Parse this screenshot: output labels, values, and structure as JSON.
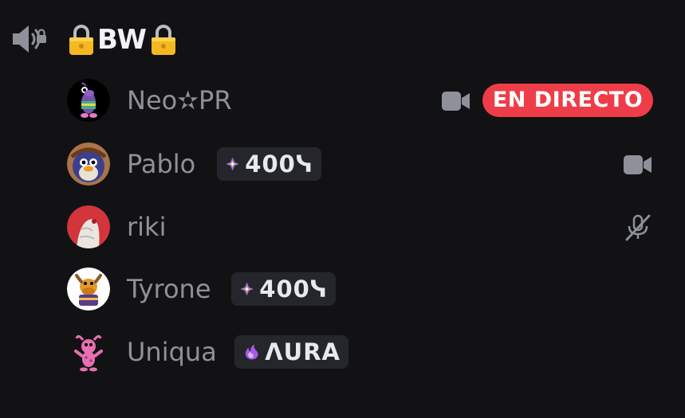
{
  "channel": {
    "icon": "speaker-locked-icon",
    "lock_icon": "lock-icon",
    "name": "BW"
  },
  "members": [
    {
      "name": "Neo✫PR",
      "avatar": "purple-character-avatar",
      "status_icon": "camera-icon",
      "live_label": "EN DIRECTO"
    },
    {
      "name": "Pablo",
      "avatar": "penguin-avatar",
      "badge": {
        "icon": "sparkle-gem-icon",
        "text": "400ᓭ"
      },
      "status_icon": "camera-icon"
    },
    {
      "name": "riki",
      "avatar": "photo-avatar",
      "status_icon": "mic-muted-icon"
    },
    {
      "name": "Tyrone",
      "avatar": "moose-avatar",
      "badge": {
        "icon": "sparkle-gem-icon",
        "text": "400ᓭ"
      }
    },
    {
      "name": "Uniqua",
      "avatar": "pink-character-avatar",
      "badge": {
        "icon": "purple-flame-icon",
        "text": "ΛURA"
      }
    }
  ],
  "colors": {
    "background": "#121214",
    "name_text": "#8e9199",
    "channel_text": "#f2f3f5",
    "badge_bg": "#25262b",
    "live_red": "#ee3d48",
    "icon_gray": "#8e9199"
  }
}
